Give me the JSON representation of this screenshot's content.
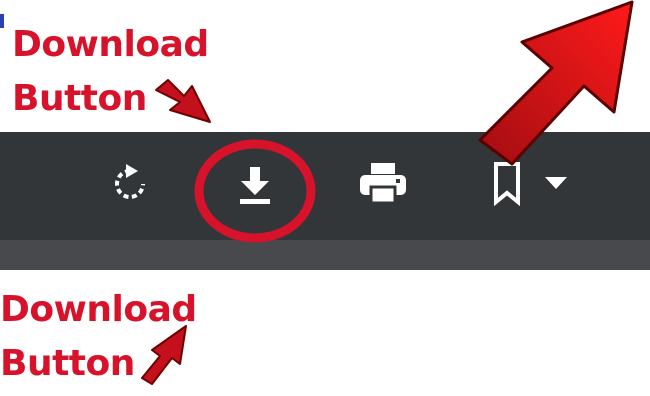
{
  "annotations": {
    "top": {
      "line1": "Download",
      "line2": "Button"
    },
    "bottom": {
      "line1": "Download",
      "line2": "Button"
    },
    "color": "#d7122b",
    "highlight_target": "download-button"
  },
  "toolbar": {
    "background": "#323639",
    "icon_color": "#ffffff",
    "buttons": [
      {
        "icon": "rotate-icon"
      },
      {
        "icon": "download-icon"
      },
      {
        "icon": "print-icon"
      },
      {
        "icon": "bookmark-icon",
        "dropdown": "caret-down-icon"
      }
    ]
  }
}
